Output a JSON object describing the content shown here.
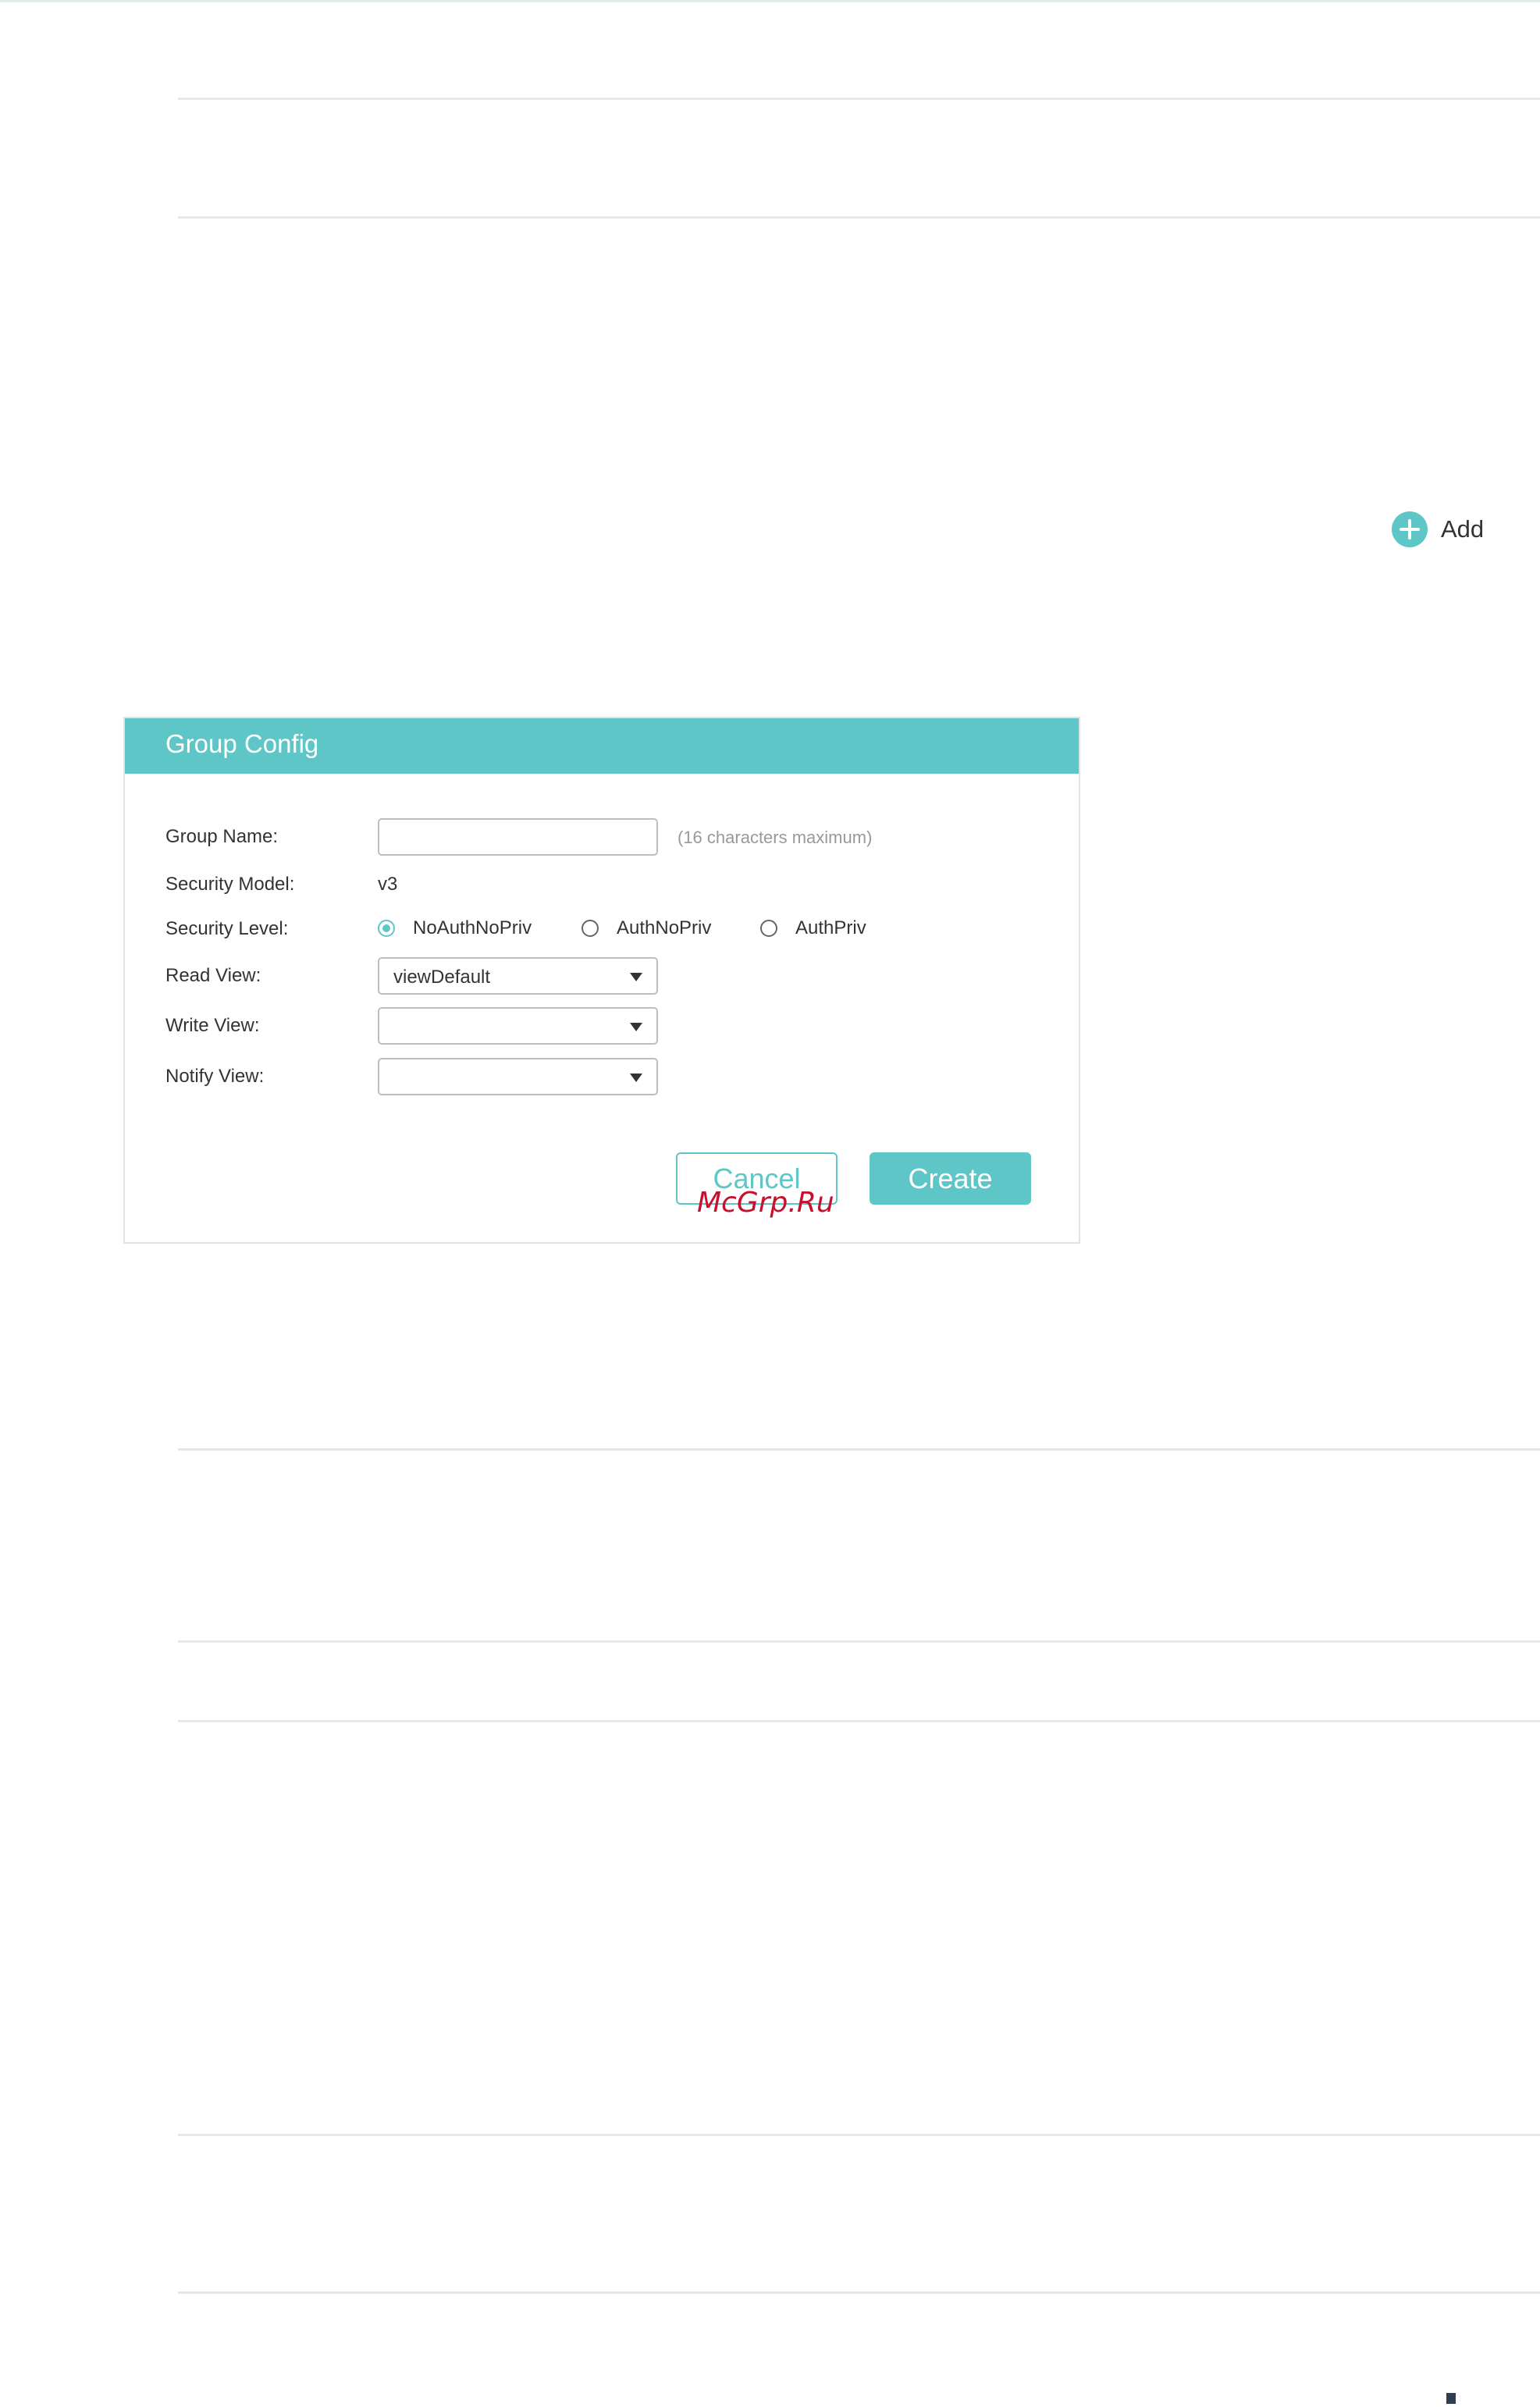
{
  "toolbar": {
    "add_label": "Add",
    "add_icon": "plus-circle-icon"
  },
  "dialog": {
    "title": "Group Config",
    "group_name": {
      "label": "Group Name:",
      "value": "",
      "hint": "(16 characters maximum)"
    },
    "security_model": {
      "label": "Security Model:",
      "value": "v3"
    },
    "security_level": {
      "label": "Security Level:",
      "selected": "NoAuthNoPriv",
      "options": [
        "NoAuthNoPriv",
        "AuthNoPriv",
        "AuthPriv"
      ]
    },
    "read_view": {
      "label": "Read View:",
      "value": "viewDefault"
    },
    "write_view": {
      "label": "Write View:",
      "value": ""
    },
    "notify_view": {
      "label": "Notify View:",
      "value": ""
    },
    "cancel_label": "Cancel",
    "create_label": "Create"
  },
  "watermark": "McGrp.Ru",
  "colors": {
    "accent": "#5ec6c6",
    "divider": "#e4e8eb",
    "watermark": "#c8102e"
  }
}
